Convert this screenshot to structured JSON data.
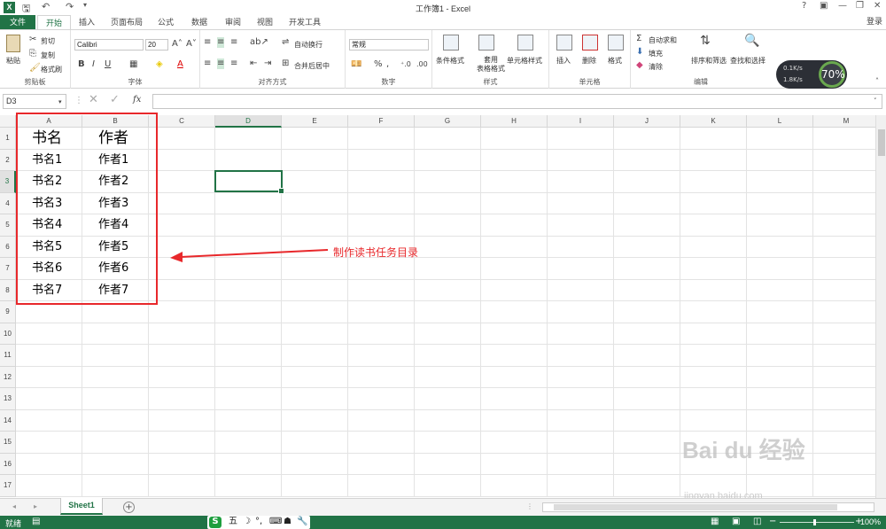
{
  "app": {
    "title": "工作簿1 - Excel",
    "login": "登录"
  },
  "tabs": [
    "文件",
    "开始",
    "插入",
    "页面布局",
    "公式",
    "数据",
    "审阅",
    "视图",
    "开发工具"
  ],
  "ribbon": {
    "clipboard": {
      "paste": "粘贴",
      "cut": "剪切",
      "copy": "复制",
      "format_painter": "格式刷",
      "label": "剪贴板"
    },
    "font": {
      "name": "Calibri",
      "size": "20",
      "label": "字体"
    },
    "alignment": {
      "wrap": "自动换行",
      "merge": "合并后居中",
      "label": "对齐方式"
    },
    "number": {
      "format": "常规",
      "percent": "%",
      "label": "数字"
    },
    "styles": {
      "conditional": "条件格式",
      "table": "套用\n表格格式",
      "cell_styles": "单元格样式",
      "label": "样式"
    },
    "cells": {
      "insert": "插入",
      "delete": "删除",
      "format": "格式",
      "label": "单元格"
    },
    "editing": {
      "autosum": "自动求和",
      "fill": "填充",
      "clear": "清除",
      "sort": "排序和筛选",
      "find": "查找和选择",
      "label": "编辑"
    }
  },
  "speed_widget": {
    "up": "0.1K/s",
    "down": "1.8K/s",
    "percent": "70%"
  },
  "formula_bar": {
    "name_box": "D3",
    "fx": "fx",
    "value": ""
  },
  "grid": {
    "columns": [
      "A",
      "B",
      "C",
      "D",
      "E",
      "F",
      "G",
      "H",
      "I",
      "J",
      "K",
      "L",
      "M"
    ],
    "rows": [
      "1",
      "2",
      "3",
      "4",
      "5",
      "6",
      "7",
      "8",
      "9",
      "10",
      "11",
      "12",
      "13",
      "14",
      "15",
      "16",
      "17"
    ],
    "selected_col": "D",
    "selected_row": "3",
    "data": [
      [
        "书名",
        "作者"
      ],
      [
        "书名1",
        "作者1"
      ],
      [
        "书名2",
        "作者2"
      ],
      [
        "书名3",
        "作者3"
      ],
      [
        "书名4",
        "作者4"
      ],
      [
        "书名5",
        "作者5"
      ],
      [
        "书名6",
        "作者6"
      ],
      [
        "书名7",
        "作者7"
      ]
    ]
  },
  "annotation": {
    "text": "制作读书任务目录",
    "color": "#e8282b"
  },
  "sheets": {
    "active": "Sheet1",
    "add": "+"
  },
  "status": {
    "ready": "就绪",
    "zoom": "100%"
  },
  "watermark": {
    "brand": "Bai du 经验",
    "url": "jingyan.baidu.com"
  },
  "colors": {
    "accent": "#217346",
    "annotation": "#e8282b"
  }
}
